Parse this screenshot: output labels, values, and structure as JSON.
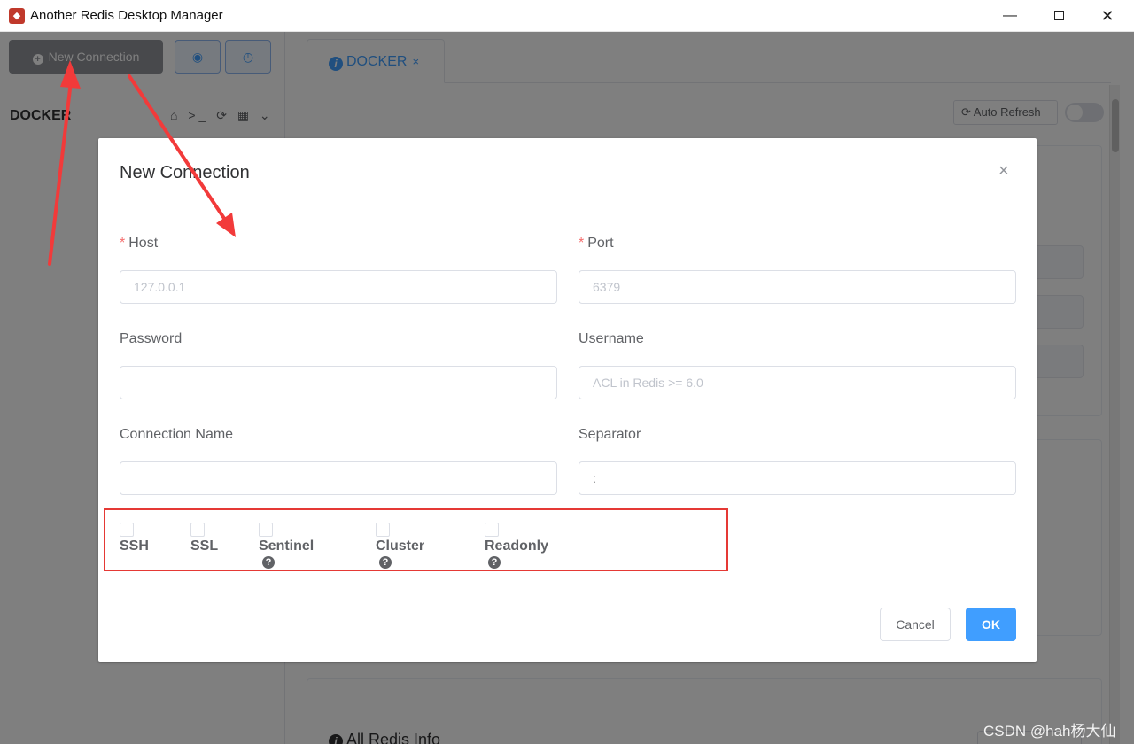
{
  "window": {
    "title": "Another Redis Desktop Manager",
    "app_icon": "redis-logo-icon",
    "minimize": "—",
    "close": "✕"
  },
  "sidebar": {
    "new_connection_label": "New Connection",
    "status_button_icon": "◉",
    "history_button_icon": "◷",
    "connection_name": "DOCKER",
    "connection_tools": "⌂ >_ ⟳ ▦ ⌄"
  },
  "main": {
    "tab_label": "DOCKER",
    "tab_close": "×",
    "auto_refresh_label": "⟳ Auto Refresh",
    "all_redis_info": "All Redis Info"
  },
  "dialog": {
    "title": "New Connection",
    "close": "×",
    "fields": {
      "host": {
        "label": "Host",
        "required_mark": "*",
        "placeholder": "127.0.0.1",
        "value": ""
      },
      "port": {
        "label": "Port",
        "required_mark": "*",
        "placeholder": "6379",
        "value": ""
      },
      "password": {
        "label": "Password",
        "placeholder": "",
        "value": ""
      },
      "username": {
        "label": "Username",
        "placeholder": "ACL in Redis >= 6.0",
        "value": ""
      },
      "connection_name": {
        "label": "Connection Name",
        "placeholder": "",
        "value": ""
      },
      "separator": {
        "label": "Separator",
        "placeholder": "",
        "value": ":"
      }
    },
    "checkboxes": [
      {
        "label": "SSH",
        "checked": false,
        "help": false
      },
      {
        "label": "SSL",
        "checked": false,
        "help": false
      },
      {
        "label": "Sentinel",
        "checked": false,
        "help": true
      },
      {
        "label": "Cluster",
        "checked": false,
        "help": true
      },
      {
        "label": "Readonly",
        "checked": false,
        "help": true
      }
    ],
    "help_glyph": "?",
    "cancel_label": "Cancel",
    "ok_label": "OK"
  },
  "colors": {
    "primary": "#409eff",
    "required": "#f56c6c",
    "annotation": "#e53935"
  },
  "watermark": "CSDN @hah杨大仙"
}
